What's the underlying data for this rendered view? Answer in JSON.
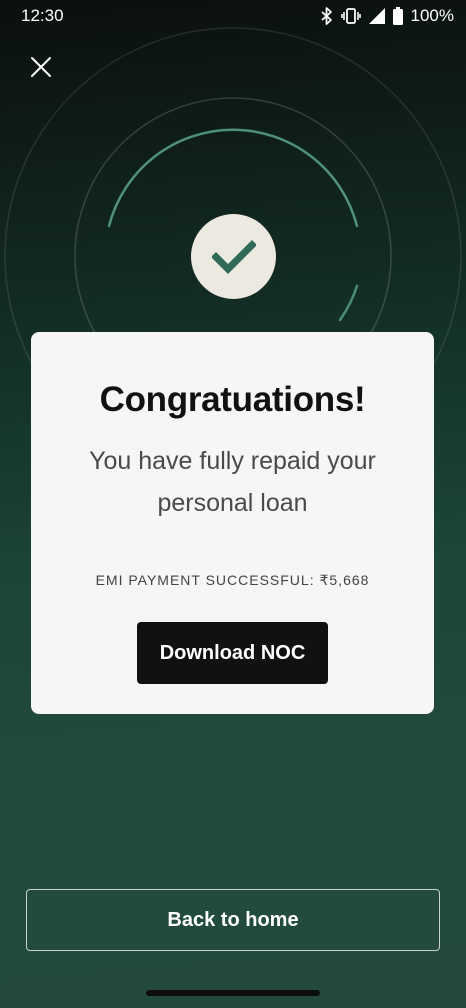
{
  "status_bar": {
    "time": "12:30",
    "battery": "100%"
  },
  "icons": {
    "close": "close-icon",
    "success": "checkmark-icon",
    "bluetooth": "bluetooth-icon",
    "vibrate": "vibrate-icon",
    "signal": "signal-icon",
    "battery": "battery-icon"
  },
  "card": {
    "title": "Congratuations!",
    "subtitle": "You have fully repaid your personal loan",
    "payment_status": "EMI PAYMENT SUCCESSFUL: ₹5,668",
    "download_label": "Download NOC"
  },
  "footer": {
    "home_label": "Back to home"
  },
  "colors": {
    "card_bg": "#f6f6f6",
    "accent_green": "#2f6b58",
    "check_bg": "#ece9e1",
    "button_dark": "#111111"
  }
}
